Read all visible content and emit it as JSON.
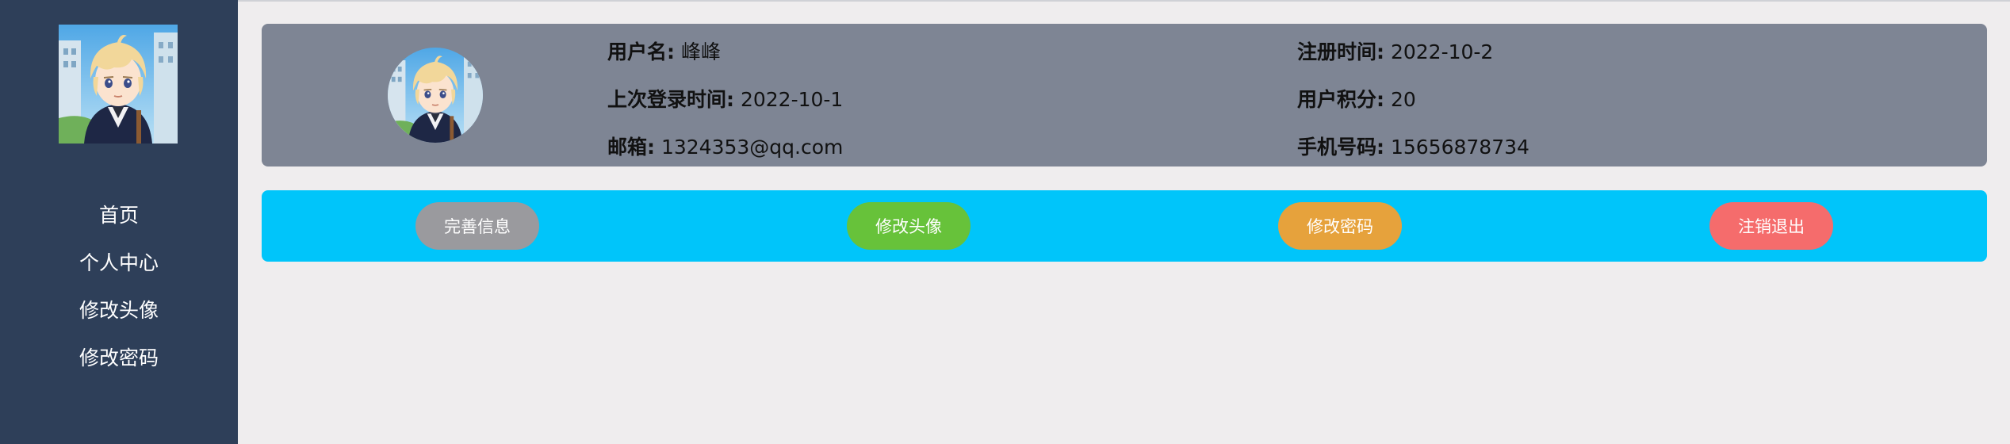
{
  "colors": {
    "sidebar_bg": "#2e3f59",
    "page_bg": "#efedee",
    "info_panel_bg": "#7e8594",
    "action_panel_bg": "#00c5fa",
    "complete_info_btn": "#9a9a9e",
    "change_avatar_btn": "#67c23a",
    "change_password_btn": "#e6a23c",
    "logout_btn": "#f56c6c"
  },
  "sidebar": {
    "avatar_icon": "anime-character-avatar",
    "nav": [
      {
        "label": "首页"
      },
      {
        "label": "个人中心"
      },
      {
        "label": "修改头像"
      },
      {
        "label": "修改密码"
      }
    ]
  },
  "profile": {
    "avatar_icon": "anime-character-avatar",
    "username_label": "用户名:",
    "username": "峰峰",
    "register_time_label": "注册时间:",
    "register_time": "2022-10-2",
    "last_login_label": "上次登录时间:",
    "last_login": "2022-10-1",
    "points_label": "用户积分:",
    "points": "20",
    "email_label": "邮箱:",
    "email": "1324353@qq.com",
    "phone_label": "手机号码:",
    "phone": "15656878734"
  },
  "actions": {
    "complete_info": "完善信息",
    "change_avatar": "修改头像",
    "change_password": "修改密码",
    "logout": "注销退出"
  }
}
